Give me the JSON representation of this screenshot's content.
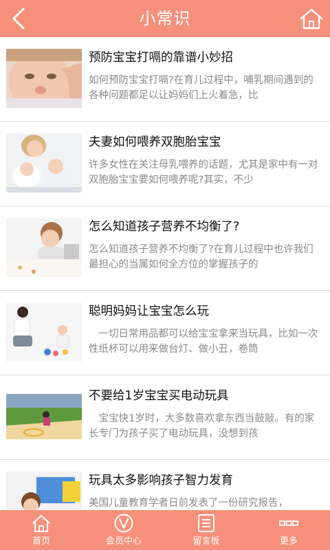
{
  "header": {
    "title": "小常识"
  },
  "articles": [
    {
      "title": "预防宝宝打嗝的靠谱小妙招",
      "desc": "如何预防宝宝打嗝?在育儿过程中，哺乳期间遇到的各种问题都足以让妈妈们上火着急，比"
    },
    {
      "title": "夫妻如何喂养双胞胎宝宝",
      "desc": "许多女性在关注母乳喂养的话题，尤其是家中有一对双胞胎宝宝要如何喂养呢?其实，不少"
    },
    {
      "title": "怎么知道孩子营养不均衡了?",
      "desc": "怎么知道孩子营养不均衡了?在育儿过程中也许我们最担心的当属如何全方位的掌握孩子的"
    },
    {
      "title": "聪明妈妈让宝宝怎么玩",
      "desc": "　一切日常用品都可以给宝宝拿来当玩具，比如一次性纸杯可以用来做台灯、做小丑，卷筒"
    },
    {
      "title": "不要给1岁宝宝买电动玩具",
      "desc": "　宝宝快1岁时，大多数喜欢拿东西当鼓敲。有的家长专门为孩子买了电动玩具，没想到孩"
    },
    {
      "title": "玩具太多影响孩子智力发育",
      "desc": "美国儿童教育学者日前发表了一份研究报告，"
    }
  ],
  "tabbar": [
    {
      "label": "首页",
      "icon": "home-outline-icon"
    },
    {
      "label": "会员中心",
      "icon": "member-v-icon"
    },
    {
      "label": "留言板",
      "icon": "message-board-icon"
    },
    {
      "label": "更多",
      "icon": "more-dots-icon"
    }
  ],
  "colors": {
    "accent": "#f7907a",
    "title_text": "#111111",
    "desc_text": "#8a8a8a",
    "divider": "#dcdcdc"
  }
}
